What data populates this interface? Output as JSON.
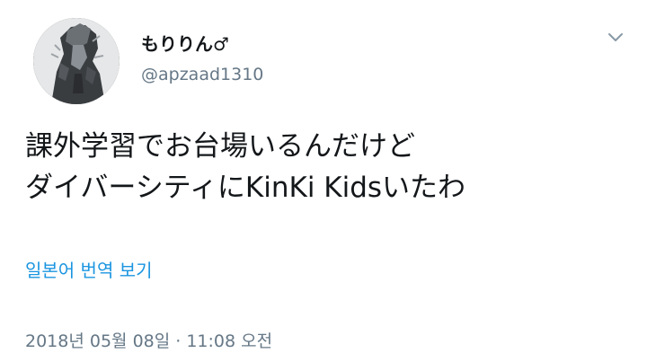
{
  "user": {
    "display_name": "もりりん♂",
    "handle": "@apzaad1310",
    "avatar_icon": "avatar-image"
  },
  "menu": {
    "icon": "chevron-down-icon"
  },
  "tweet": {
    "line1": "課外学習でお台場いるんだけど",
    "line2": "ダイバーシティにKinKi Kidsいたわ"
  },
  "translate": {
    "label": "일본어 번역 보기"
  },
  "meta": {
    "timestamp": "2018년 05월 08일 · 11:08 오전"
  },
  "colors": {
    "link": "#1b95e0",
    "secondary_text": "#657786",
    "primary_text": "#14171a"
  }
}
